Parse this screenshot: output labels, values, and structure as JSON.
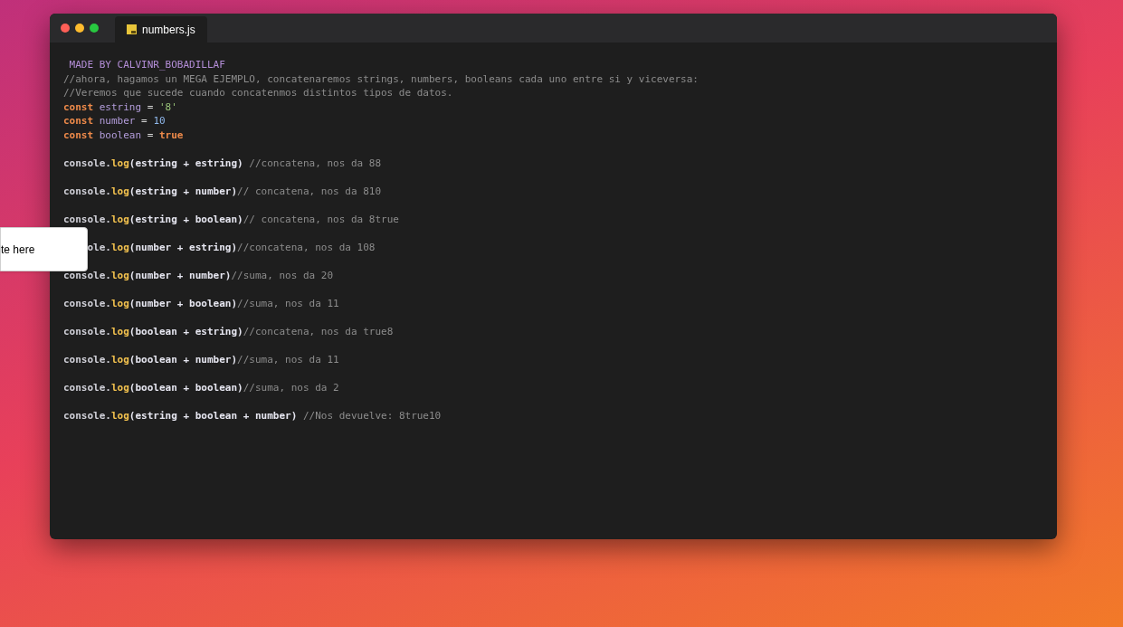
{
  "window": {
    "tab": {
      "label": "numbers.js",
      "selected": true
    }
  },
  "code": [
    {
      "kind": "header",
      "tokens": [
        {
          "kind": "banner",
          "text": " MADE BY CALVINR_BOBADILLAF"
        }
      ]
    },
    {
      "kind": "header",
      "tokens": [
        {
          "kind": "comment",
          "text": "//ahora, hagamos un MEGA EJEMPLO, concatenaremos strings, numbers, booleans cada uno entre si y viceversa:"
        }
      ]
    },
    {
      "kind": "header",
      "tokens": [
        {
          "kind": "comment",
          "text": "//Veremos que sucede cuando concatenmos distintos tipos de datos."
        }
      ]
    },
    {
      "kind": "header",
      "tokens": [
        {
          "kind": "keyword",
          "text": "const "
        },
        {
          "kind": "variable",
          "text": "estring"
        },
        {
          "kind": "operator",
          "text": " = "
        },
        {
          "kind": "string",
          "text": "'8'"
        }
      ]
    },
    {
      "kind": "header",
      "tokens": [
        {
          "kind": "keyword",
          "text": "const "
        },
        {
          "kind": "variable",
          "text": "number"
        },
        {
          "kind": "operator",
          "text": " = "
        },
        {
          "kind": "number",
          "text": "10"
        }
      ]
    },
    {
      "kind": "header",
      "tokens": [
        {
          "kind": "keyword",
          "text": "const "
        },
        {
          "kind": "variable",
          "text": "boolean"
        },
        {
          "kind": "operator",
          "text": " = "
        },
        {
          "kind": "boolean",
          "text": "true"
        }
      ]
    },
    {
      "kind": "statement",
      "covered": false,
      "tokens": [
        {
          "kind": "object",
          "text": "console."
        },
        {
          "kind": "method",
          "text": "log"
        },
        {
          "kind": "args",
          "text": "(estring + estring) "
        },
        {
          "kind": "comment",
          "text": "//concatena, nos da 88"
        }
      ]
    },
    {
      "kind": "statement",
      "covered": false,
      "tokens": [
        {
          "kind": "object",
          "text": "console."
        },
        {
          "kind": "method",
          "text": "log"
        },
        {
          "kind": "args",
          "text": "(estring + number)"
        },
        {
          "kind": "comment",
          "text": "// concatena, nos da 810"
        }
      ]
    },
    {
      "kind": "statement",
      "covered": false,
      "tokens": [
        {
          "kind": "object",
          "text": "console."
        },
        {
          "kind": "method",
          "text": "log"
        },
        {
          "kind": "args",
          "text": "(estring + boolean)"
        },
        {
          "kind": "comment",
          "text": "// concatena, nos da 8true"
        }
      ]
    },
    {
      "kind": "statement",
      "covered": true,
      "tokens": [
        {
          "kind": "object",
          "text": "ole."
        },
        {
          "kind": "method",
          "text": "log"
        },
        {
          "kind": "args",
          "text": "(number + estring)"
        },
        {
          "kind": "comment",
          "text": "//concatena, nos da 108"
        }
      ]
    },
    {
      "kind": "statement",
      "covered": false,
      "tokens": [
        {
          "kind": "object",
          "text": "console."
        },
        {
          "kind": "method",
          "text": "log"
        },
        {
          "kind": "args",
          "text": "(number + number)"
        },
        {
          "kind": "comment",
          "text": "//suma, nos da 20"
        }
      ]
    },
    {
      "kind": "statement",
      "covered": false,
      "tokens": [
        {
          "kind": "object",
          "text": "console."
        },
        {
          "kind": "method",
          "text": "log"
        },
        {
          "kind": "args",
          "text": "(number + boolean)"
        },
        {
          "kind": "comment",
          "text": "//suma, nos da 11"
        }
      ]
    },
    {
      "kind": "statement",
      "covered": false,
      "tokens": [
        {
          "kind": "object",
          "text": "console."
        },
        {
          "kind": "method",
          "text": "log"
        },
        {
          "kind": "args",
          "text": "(boolean + estring)"
        },
        {
          "kind": "comment",
          "text": "//concatena, nos da true8"
        }
      ]
    },
    {
      "kind": "statement",
      "covered": false,
      "tokens": [
        {
          "kind": "object",
          "text": "console."
        },
        {
          "kind": "method",
          "text": "log"
        },
        {
          "kind": "args",
          "text": "(boolean + number)"
        },
        {
          "kind": "comment",
          "text": "//suma, nos da 11"
        }
      ]
    },
    {
      "kind": "statement",
      "covered": false,
      "tokens": [
        {
          "kind": "object",
          "text": "console."
        },
        {
          "kind": "method",
          "text": "log"
        },
        {
          "kind": "args",
          "text": "(boolean + boolean)"
        },
        {
          "kind": "comment",
          "text": "//suma, nos da 2"
        }
      ]
    },
    {
      "kind": "statement",
      "covered": false,
      "tokens": [
        {
          "kind": "object",
          "text": "console."
        },
        {
          "kind": "method",
          "text": "log"
        },
        {
          "kind": "args",
          "text": "(estring + boolean + number) "
        },
        {
          "kind": "comment",
          "text": "//Nos devuelve: 8true10"
        }
      ]
    }
  ],
  "note": {
    "text": "te here"
  }
}
